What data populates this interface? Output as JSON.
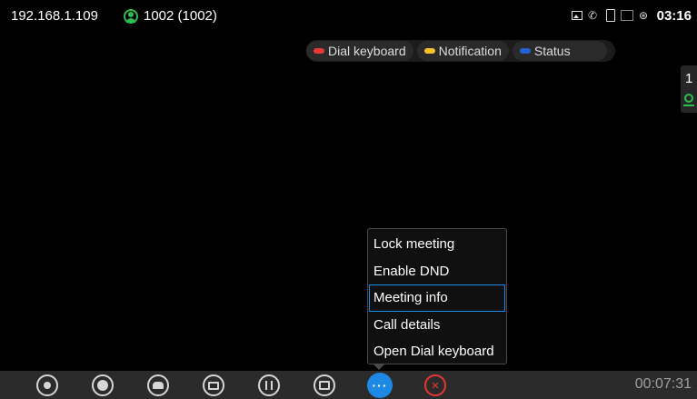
{
  "status_bar": {
    "ip": "192.168.1.109",
    "account": "1002 (1002)",
    "account_status_color": "#2dbd4f",
    "icons": [
      "image-icon",
      "phone-icon",
      "sim-icon",
      "network-icon",
      "wifi-icon"
    ],
    "time": "03:16"
  },
  "legend": {
    "dial_keyboard": {
      "label": "Dial keyboard",
      "color": "#e53935"
    },
    "notification": {
      "label": "Notification",
      "color": "#fbc02d"
    },
    "status": {
      "label": "Status",
      "color": "#1e63c9"
    }
  },
  "side_tab": {
    "count": "1"
  },
  "menu": {
    "items": [
      {
        "label": "Lock meeting",
        "selected": false
      },
      {
        "label": "Enable DND",
        "selected": false
      },
      {
        "label": "Meeting info",
        "selected": true
      },
      {
        "label": "Call details",
        "selected": false
      },
      {
        "label": "Open Dial keyboard",
        "selected": false
      }
    ]
  },
  "toolbar": {
    "buttons": [
      "add-participant-icon",
      "record-icon",
      "participants-icon",
      "layout-icon",
      "pause-icon",
      "camera-icon",
      "more-icon",
      "hangup-icon"
    ],
    "accent_color": "#1e88e5",
    "hangup_color": "#e53935",
    "call_duration": "00:07:31"
  }
}
